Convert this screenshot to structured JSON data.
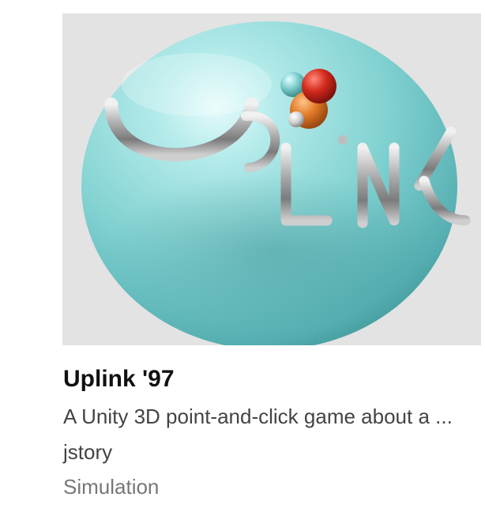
{
  "game": {
    "title": "Uplink '97",
    "description": "A Unity 3D point-and-click game about a ...",
    "author": "jstory",
    "genre": "Simulation",
    "cover": {
      "logo_text": "UPLINK",
      "background_color": "#e3e3e3",
      "sphere_color": "#86d6d6",
      "letter_color": "#9a9a9a"
    }
  }
}
